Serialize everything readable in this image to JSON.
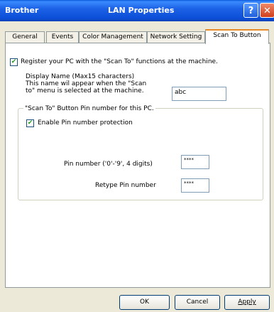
{
  "window": {
    "left_title": "Brother",
    "title": "LAN Properties",
    "help_label": "?",
    "close_label": "✕"
  },
  "tabs": [
    {
      "label": "General"
    },
    {
      "label": "Events"
    },
    {
      "label": "Color Management"
    },
    {
      "label": "Network Setting"
    },
    {
      "label": "Scan To Button",
      "active": true
    }
  ],
  "scan": {
    "register_checked": true,
    "register_label": "Register your PC with the \"Scan To\" functions at the machine.",
    "display_name_title": "Display Name (Max15 characters)",
    "display_name_desc1": "This name wil appear when the \"Scan",
    "display_name_desc2": "to\" menu is selected at the machine.",
    "display_name_value": "abc",
    "group_title": "\"Scan To\" Button Pin number for this PC.",
    "pin_protect_checked": true,
    "pin_protect_label": "Enable Pin number protection",
    "pin_label": "Pin number ('0'-'9', 4 digits)",
    "pin_value": "****",
    "retype_label": "Retype Pin number",
    "retype_value": "****"
  },
  "buttons": {
    "ok": "OK",
    "cancel": "Cancel",
    "apply": "Apply"
  },
  "check_mark": "✔"
}
